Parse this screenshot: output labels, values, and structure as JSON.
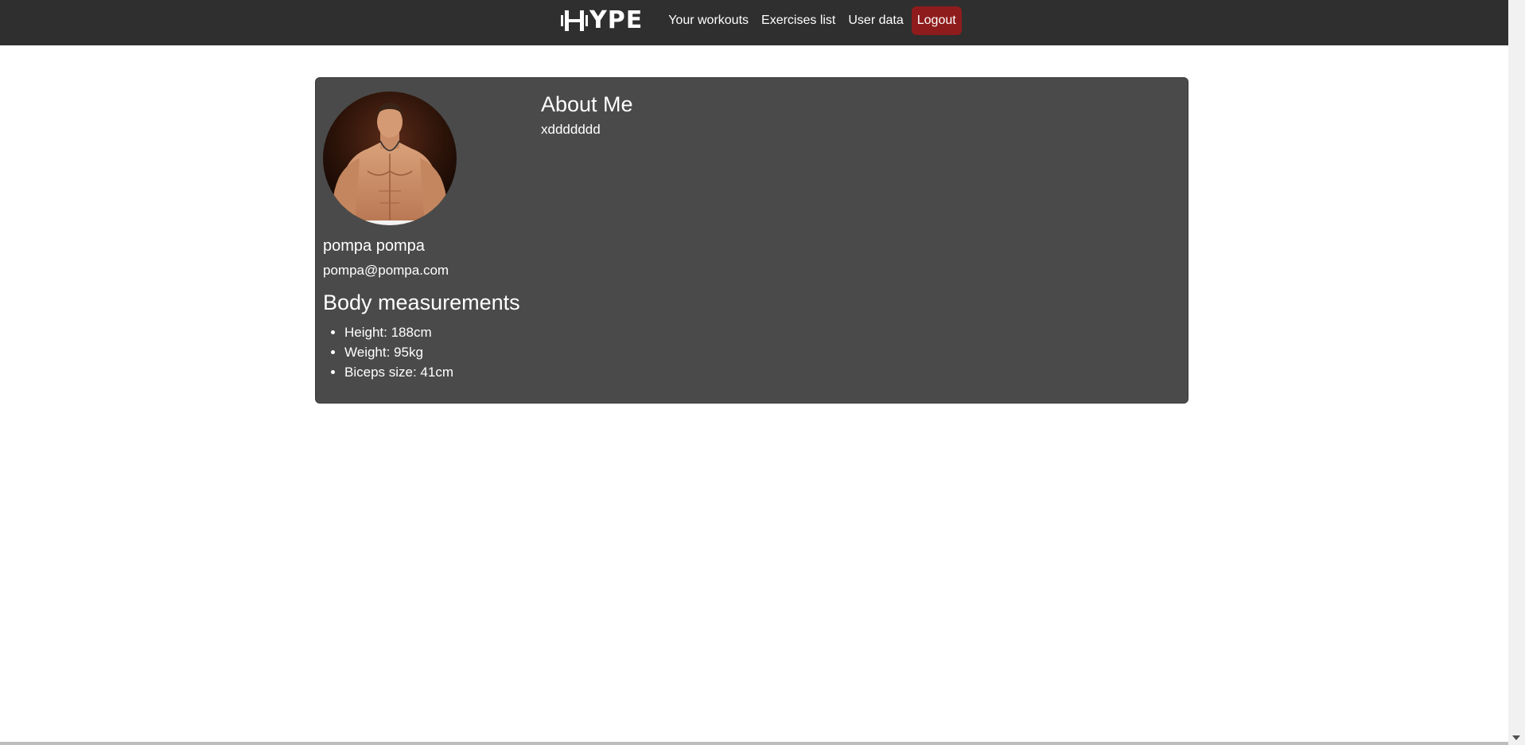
{
  "nav": {
    "logo_text": "YPE",
    "links": [
      "Your workouts",
      "Exercises list",
      "User data"
    ],
    "logout_label": "Logout",
    "logout_color": "#8f1c1c"
  },
  "profile": {
    "full_name": "pompa pompa",
    "email": "pompa@pompa.com",
    "avatar_icon": "profile-photo",
    "measurements_title": "Body measurements",
    "measurements": [
      "Height: 188cm",
      "Weight: 95kg",
      "Biceps size: 41cm"
    ],
    "about_title": "About Me",
    "about_text": "xddddddd"
  },
  "colors": {
    "navbar_bg": "#2f2f2f",
    "card_bg": "#4a4a4a"
  }
}
